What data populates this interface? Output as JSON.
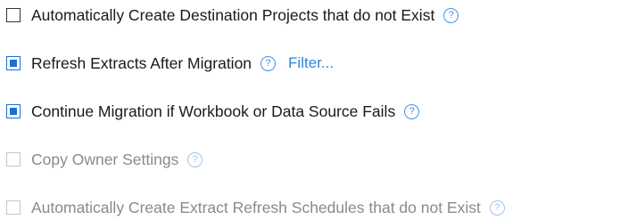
{
  "options": [
    {
      "label": "Automatically Create Destination Projects that do not Exist",
      "checked": false,
      "enabled": true,
      "help_icon": "question-circle-icon",
      "help_glyph": "?"
    },
    {
      "label": "Refresh Extracts After Migration",
      "checked": true,
      "enabled": true,
      "help_icon": "question-circle-icon",
      "help_glyph": "?",
      "link_label": "Filter..."
    },
    {
      "label": "Continue Migration if Workbook or Data Source Fails",
      "checked": true,
      "enabled": true,
      "help_icon": "question-circle-icon",
      "help_glyph": "?"
    },
    {
      "label": "Copy Owner Settings",
      "checked": false,
      "enabled": false,
      "help_icon": "question-circle-icon",
      "help_glyph": "?"
    },
    {
      "label": "Automatically Create Extract Refresh Schedules that do not Exist",
      "checked": false,
      "enabled": false,
      "help_icon": "question-circle-icon",
      "help_glyph": "?"
    }
  ],
  "colors": {
    "accent": "#1e6fd0",
    "link": "#2f86d9",
    "help_icon": "#4a90e2",
    "text": "#1a1a1a",
    "text_disabled": "#8a8a8a"
  }
}
